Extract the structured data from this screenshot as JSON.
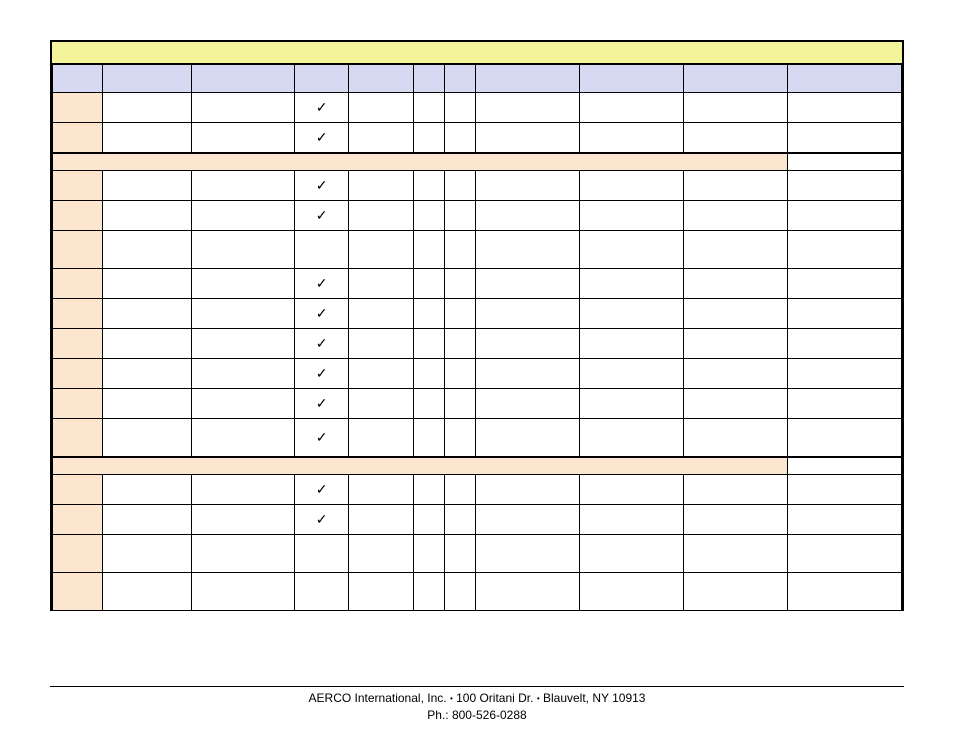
{
  "title_bar": "",
  "columns": [
    "",
    "",
    "",
    "",
    "",
    "",
    "",
    "",
    "",
    "",
    ""
  ],
  "sections": [
    {
      "rows": [
        {
          "label": "",
          "cells": [
            "",
            "",
            "✓",
            "",
            "",
            "",
            "",
            "",
            "",
            ""
          ],
          "tall": false
        },
        {
          "label": "",
          "cells": [
            "",
            "",
            "✓",
            "",
            "",
            "",
            "",
            "",
            "",
            ""
          ],
          "tall": false
        }
      ]
    },
    {
      "section_band_last_white": true,
      "rows": [
        {
          "label": "",
          "cells": [
            "",
            "",
            "✓",
            "",
            "",
            "",
            "",
            "",
            "",
            ""
          ],
          "tall": false
        },
        {
          "label": "",
          "cells": [
            "",
            "",
            "✓",
            "",
            "",
            "",
            "",
            "",
            "",
            ""
          ],
          "tall": false
        },
        {
          "label": "",
          "cells": [
            "",
            "",
            "",
            "",
            "",
            "",
            "",
            "",
            "",
            ""
          ],
          "tall": true
        },
        {
          "label": "",
          "cells": [
            "",
            "",
            "✓",
            "",
            "",
            "",
            "",
            "",
            "",
            ""
          ],
          "tall": false
        },
        {
          "label": "",
          "cells": [
            "",
            "",
            "✓",
            "",
            "",
            "",
            "",
            "",
            "",
            ""
          ],
          "tall": false
        },
        {
          "label": "",
          "cells": [
            "",
            "",
            "✓",
            "",
            "",
            "",
            "",
            "",
            "",
            ""
          ],
          "tall": false
        },
        {
          "label": "",
          "cells": [
            "",
            "",
            "✓",
            "",
            "",
            "",
            "",
            "",
            "",
            ""
          ],
          "tall": false
        },
        {
          "label": "",
          "cells": [
            "",
            "",
            "✓",
            "",
            "",
            "",
            "",
            "",
            "",
            ""
          ],
          "tall": false
        },
        {
          "label": "",
          "cells": [
            "",
            "",
            "✓",
            "",
            "",
            "",
            "",
            "",
            "",
            ""
          ],
          "tall": true
        }
      ]
    },
    {
      "section_band_last_white": true,
      "rows": [
        {
          "label": "",
          "cells": [
            "",
            "",
            "✓",
            "",
            "",
            "",
            "",
            "",
            "",
            ""
          ],
          "tall": false
        },
        {
          "label": "",
          "cells": [
            "",
            "",
            "✓",
            "",
            "",
            "",
            "",
            "",
            "",
            ""
          ],
          "tall": false
        },
        {
          "label": "",
          "cells": [
            "",
            "",
            "",
            "",
            "",
            "",
            "",
            "",
            "",
            ""
          ],
          "tall": true
        },
        {
          "label": "",
          "cells": [
            "",
            "",
            "",
            "",
            "",
            "",
            "",
            "",
            "",
            ""
          ],
          "tall": true
        }
      ]
    }
  ],
  "footer_line1_parts": [
    "AERCO International, Inc.",
    "100 Oritani Dr.",
    "Blauvelt, NY 10913"
  ],
  "footer_line2": "Ph.: 800-526-0288",
  "checkmark": "✓",
  "bullet": "•"
}
